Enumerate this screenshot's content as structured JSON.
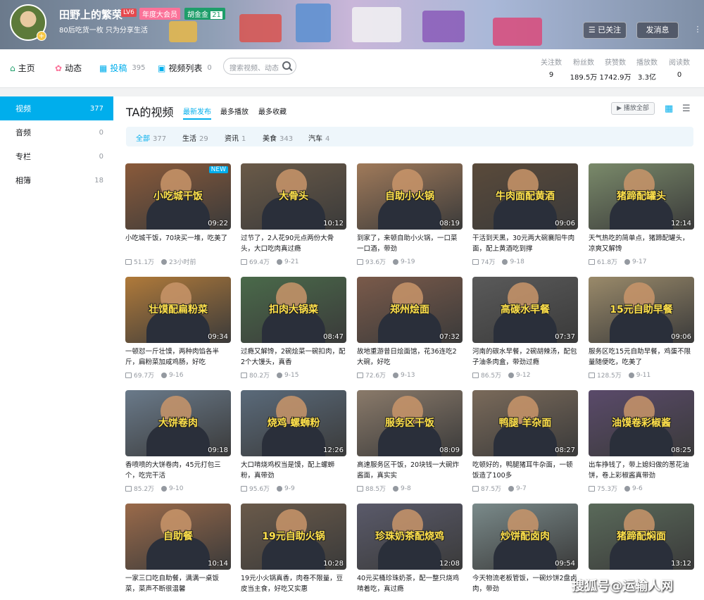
{
  "header": {
    "username": "田野上的繁荣",
    "level": "LV6",
    "badge_year": "年度大会员",
    "badge_fans": "胡金金",
    "badge_fans_level": "21",
    "signature": "80后吃货一枚 只为分享生活",
    "follow_button": "已关注",
    "message_button": "发消息"
  },
  "nav": {
    "home": "主页",
    "dynamic": "动态",
    "submissions": "投稿",
    "submissions_count": "395",
    "collections": "视频列表",
    "collections_count": "0",
    "search_placeholder": "搜索视频、动态"
  },
  "stats": [
    {
      "label": "关注数",
      "value": "9"
    },
    {
      "label": "粉丝数",
      "value": "189.5万"
    },
    {
      "label": "获赞数",
      "value": "1742.9万"
    },
    {
      "label": "播放数",
      "value": "3.3亿"
    },
    {
      "label": "阅读数",
      "value": "0"
    }
  ],
  "sidebar": [
    {
      "label": "视频",
      "count": "377"
    },
    {
      "label": "音频",
      "count": "0"
    },
    {
      "label": "专栏",
      "count": "0"
    },
    {
      "label": "相簿",
      "count": "18"
    }
  ],
  "main": {
    "title": "TA的视频",
    "sort_tabs": [
      "最新发布",
      "最多播放",
      "最多收藏"
    ],
    "play_all": "播放全部"
  },
  "filters": [
    {
      "label": "全部",
      "count": "377"
    },
    {
      "label": "生活",
      "count": "29"
    },
    {
      "label": "资讯",
      "count": "1"
    },
    {
      "label": "美食",
      "count": "343"
    },
    {
      "label": "汽车",
      "count": "4"
    }
  ],
  "videos": [
    {
      "caption": "小吃城干饭",
      "duration": "09:22",
      "new": "NEW",
      "title": "小吃城干饭，70块买一堆，吃美了",
      "views": "51.1万",
      "date": "23小时前",
      "color": "#8a5a3a"
    },
    {
      "caption": "大骨头",
      "duration": "10:12",
      "title": "过节了，2人花90元点两份大骨头，大口吃肉真过瘾",
      "views": "69.4万",
      "date": "9-21",
      "color": "#6a5a48"
    },
    {
      "caption": "自助小火锅",
      "duration": "08:19",
      "title": "到家了，来顿自助小火锅，一口菜一口酒，带劲",
      "views": "93.6万",
      "date": "9-19",
      "color": "#a07a5a"
    },
    {
      "caption": "牛肉面配黄酒",
      "duration": "09:06",
      "title": "干活到天黑，30元两大碗襄阳牛肉面，配上黄酒吃到撑",
      "views": "74万",
      "date": "9-18",
      "color": "#5a4a3a"
    },
    {
      "caption": "猪蹄配罐头",
      "duration": "12:14",
      "title": "天气热吃的简单点，猪蹄配罐头，凉爽又解馋",
      "views": "61.8万",
      "date": "9-17",
      "color": "#7a8a6a"
    },
    {
      "caption": "壮馍配扁粉菜",
      "duration": "09:34",
      "title": "一顿怼一斤壮馍，两种肉馅各半斤，扁粉菜加咸鸡肠，好吃",
      "views": "69.7万",
      "date": "9-16",
      "color": "#b07a3a"
    },
    {
      "caption": "扣肉大锅菜",
      "duration": "08:47",
      "title": "过瘾又解馋，2碗烩菜一碗扣肉，配2个大馒头，真香",
      "views": "80.2万",
      "date": "9-15",
      "color": "#4a6a4a"
    },
    {
      "caption": "郑州烩面",
      "duration": "07:32",
      "title": "故地重游昔日烩面馆，花36连吃2大碗，好吃",
      "views": "72.6万",
      "date": "9-13",
      "color": "#7a5a4a"
    },
    {
      "caption": "高碳水早餐",
      "duration": "07:37",
      "title": "河南的碳水早餐，2碗胡辣汤，配包子油条肉盒，带劲过瘾",
      "views": "86.5万",
      "date": "9-12",
      "color": "#5a5a5a"
    },
    {
      "caption": "15元自助早餐",
      "duration": "09:06",
      "title": "服务区吃15元自助早餐，鸡蛋不限量随便吃，吃美了",
      "views": "128.5万",
      "date": "9-11",
      "color": "#9a8a6a"
    },
    {
      "caption": "大饼卷肉",
      "duration": "09:18",
      "title": "香喷喷的大饼卷肉，45元打包三个，吃完干活",
      "views": "85.2万",
      "date": "9-10",
      "color": "#6a7a8a"
    },
    {
      "caption": "烧鸡 螺蛳粉",
      "duration": "12:26",
      "title": "大口啃烧鸡权当是馍，配上螺蛳粉，真带劲",
      "views": "95.6万",
      "date": "9-9",
      "color": "#5a6a7a"
    },
    {
      "caption": "服务区干饭",
      "duration": "08:09",
      "title": "高速服务区干饭，20块钱一大碗炸酱面，真实实",
      "views": "88.5万",
      "date": "9-8",
      "color": "#8a7a6a"
    },
    {
      "caption": "鸭腿 羊杂面",
      "duration": "08:27",
      "title": "吃顿好的，鸭腿猪耳牛杂面，一顿饭造了100多",
      "views": "87.5万",
      "date": "9-7",
      "color": "#7a6a5a"
    },
    {
      "caption": "油馍卷彩椒酱",
      "duration": "08:25",
      "title": "出车挣钱了，带上媳妇做的葱花油饼，卷上彩椒酱真带劲",
      "views": "75.3万",
      "date": "9-6",
      "color": "#5a4a6a"
    },
    {
      "caption": "自助餐",
      "duration": "10:14",
      "title": "一家三口吃自助餐，满满一桌饭菜，菜声不断很温馨",
      "views": "",
      "date": "",
      "color": "#9a6a4a"
    },
    {
      "caption": "19元自助火锅",
      "duration": "10:28",
      "title": "19元小火锅真香，肉卷不限量，豆皮当主食，好吃又实惠",
      "views": "",
      "date": "",
      "color": "#6a5a4a"
    },
    {
      "caption": "珍珠奶茶配烧鸡",
      "duration": "12:08",
      "title": "40元买桶珍珠奶茶，配一整只烧鸡啃着吃，真过瘾",
      "views": "",
      "date": "",
      "color": "#5a5a6a"
    },
    {
      "caption": "炒饼配卤肉",
      "duration": "09:54",
      "title": "今天物流老板管饭，一碗炒饼2盘卤肉，带劲",
      "views": "",
      "date": "",
      "color": "#7a8a8a"
    },
    {
      "caption": "猪蹄配焖面",
      "duration": "13:12",
      "title": "",
      "views": "",
      "date": "",
      "color": "#5a6a5a"
    }
  ],
  "watermark": "搜狐号@运输人网",
  "colors": {
    "accent": "#00aeec",
    "caption": "#ffe14a"
  }
}
